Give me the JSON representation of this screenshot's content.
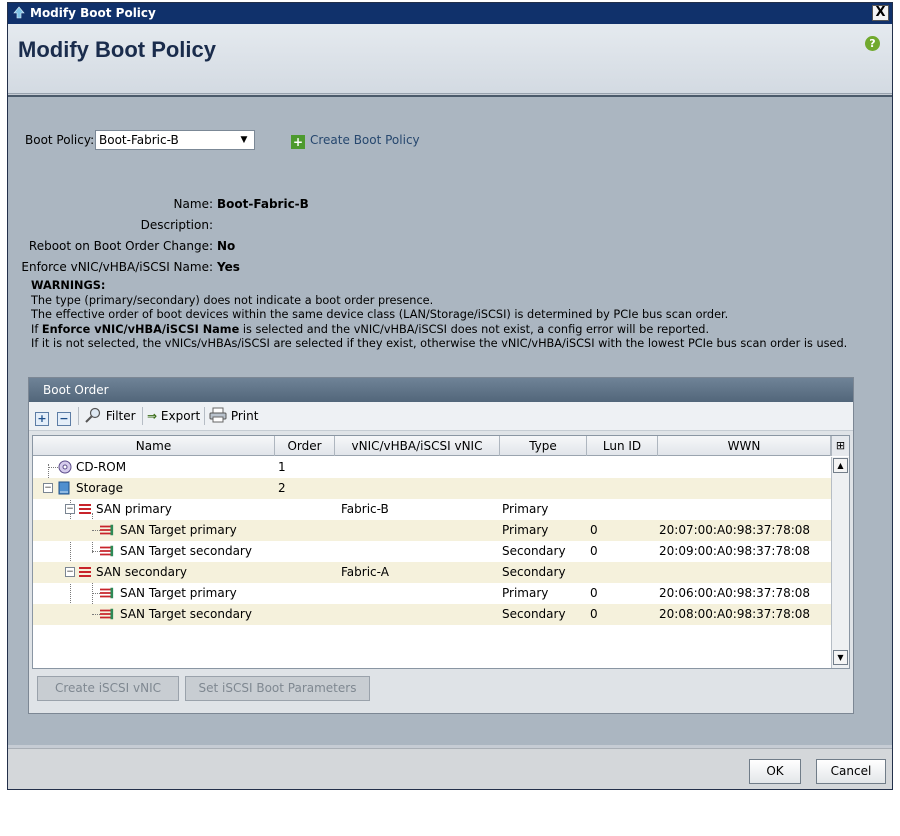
{
  "window": {
    "title": "Modify Boot Policy",
    "close_label": "X"
  },
  "header": {
    "title": "Modify Boot Policy",
    "help_label": "?"
  },
  "policy": {
    "label": "Boot Policy:",
    "selected": "Boot-Fabric-B",
    "create_label": "Create Boot Policy"
  },
  "properties": [
    {
      "label": "Name:",
      "value": "Boot-Fabric-B"
    },
    {
      "label": "Description:",
      "value": ""
    },
    {
      "label": "Reboot on Boot Order Change:",
      "value": "No"
    },
    {
      "label": "Enforce vNIC/vHBA/iSCSI Name:",
      "value": "Yes"
    }
  ],
  "warnings": {
    "title": "WARNINGS:",
    "line1": "The type (primary/secondary) does not indicate a boot order presence.",
    "line2": "The effective order of boot devices within the same device class (LAN/Storage/iSCSI) is determined by PCIe bus scan order.",
    "line3_pre": "If ",
    "line3_bold": "Enforce vNIC/vHBA/iSCSI Name",
    "line3_post": " is selected and the vNIC/vHBA/iSCSI does not exist, a config error will be reported.",
    "line4": "If it is not selected, the vNICs/vHBAs/iSCSI are selected if they exist, otherwise the vNIC/vHBA/iSCSI with the lowest PCIe bus scan order is used."
  },
  "boot_order": {
    "title": "Boot Order",
    "toolbar": {
      "filter": "Filter",
      "export": "Export",
      "print": "Print"
    },
    "columns": [
      "Name",
      "Order",
      "vNIC/vHBA/iSCSI vNIC",
      "Type",
      "Lun ID",
      "WWN"
    ],
    "rows": [
      {
        "name": "CD-ROM",
        "order": "1",
        "vnic": "",
        "type": "",
        "lun": "",
        "wwn": ""
      },
      {
        "name": "Storage",
        "order": "2",
        "vnic": "",
        "type": "",
        "lun": "",
        "wwn": ""
      },
      {
        "name": "SAN primary",
        "order": "",
        "vnic": "Fabric-B",
        "type": "Primary",
        "lun": "",
        "wwn": ""
      },
      {
        "name": "SAN Target primary",
        "order": "",
        "vnic": "",
        "type": "Primary",
        "lun": "0",
        "wwn": "20:07:00:A0:98:37:78:08"
      },
      {
        "name": "SAN Target secondary",
        "order": "",
        "vnic": "",
        "type": "Secondary",
        "lun": "0",
        "wwn": "20:09:00:A0:98:37:78:08"
      },
      {
        "name": "SAN secondary",
        "order": "",
        "vnic": "Fabric-A",
        "type": "Secondary",
        "lun": "",
        "wwn": ""
      },
      {
        "name": "SAN Target primary",
        "order": "",
        "vnic": "",
        "type": "Primary",
        "lun": "0",
        "wwn": "20:06:00:A0:98:37:78:08"
      },
      {
        "name": "SAN Target secondary",
        "order": "",
        "vnic": "",
        "type": "Secondary",
        "lun": "0",
        "wwn": "20:08:00:A0:98:37:78:08"
      }
    ],
    "buttons": {
      "create_iscsi": "Create iSCSI vNIC",
      "set_iscsi": "Set iSCSI Boot Parameters"
    }
  },
  "footer": {
    "ok": "OK",
    "cancel": "Cancel"
  }
}
